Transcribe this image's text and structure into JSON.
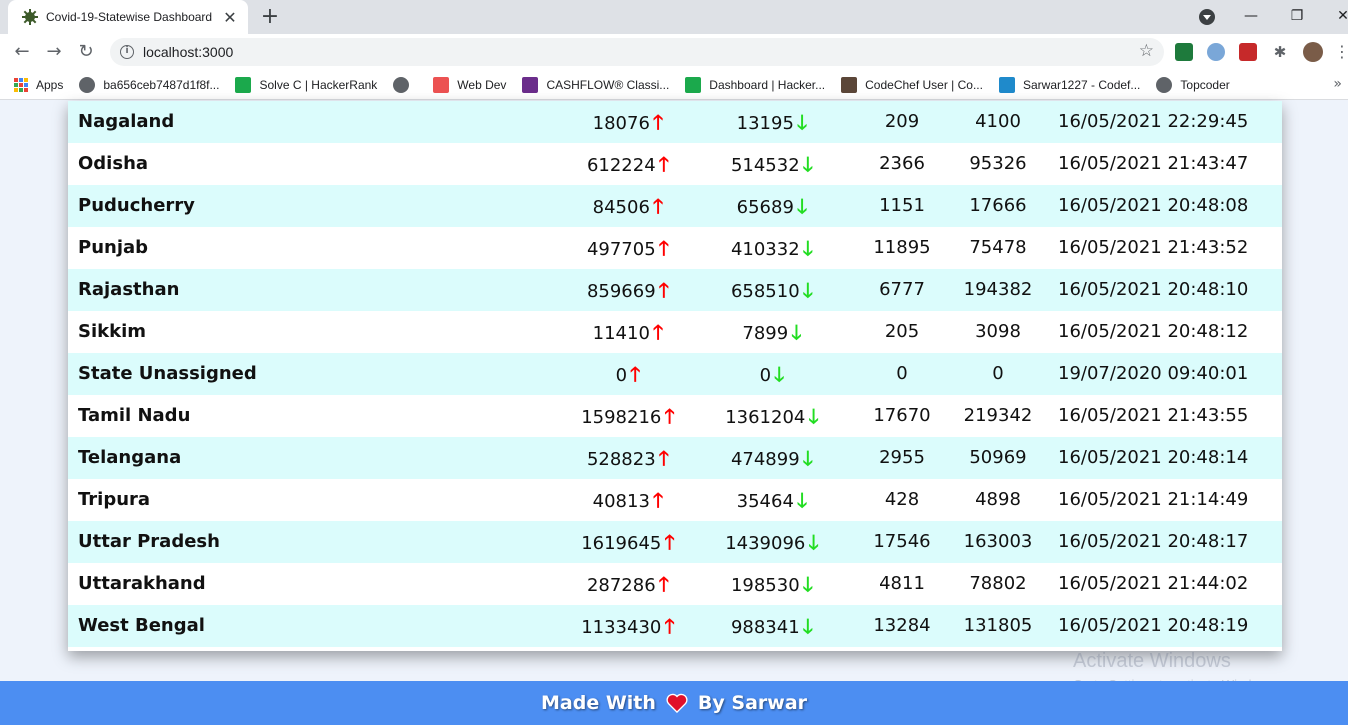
{
  "browser": {
    "tab_title": "Covid-19-Statewise Dashboard",
    "tab_close": "✕",
    "new_tab": "+",
    "url": "localhost:3000",
    "bookmarks": [
      {
        "label": "Apps",
        "icon": "apps-grid-icon",
        "color": "#4285f4"
      },
      {
        "label": "ba656ceb7487d1f8f...",
        "icon": "globe-icon",
        "color": "#5f6368"
      },
      {
        "label": "Solve C | HackerRank",
        "icon": "hackerrank-icon",
        "color": "#1ba94c"
      },
      {
        "label": "",
        "icon": "globe-icon",
        "color": "#5f6368"
      },
      {
        "label": "Web Dev",
        "icon": "udemy-icon",
        "color": "#ec5252"
      },
      {
        "label": "CASHFLOW® Classi...",
        "icon": "cashflow-icon",
        "color": "#6b2d8b"
      },
      {
        "label": "Dashboard | Hacker...",
        "icon": "hackerrank-icon",
        "color": "#1ba94c"
      },
      {
        "label": "CodeChef User | Co...",
        "icon": "codechef-icon",
        "color": "#5b4638"
      },
      {
        "label": "Sarwar1227 - Codef...",
        "icon": "codeforces-icon",
        "color": "#1f8acb"
      },
      {
        "label": "Topcoder",
        "icon": "globe-icon",
        "color": "#5f6368"
      }
    ],
    "bookmarks_more": "»"
  },
  "table": {
    "rows": [
      {
        "state": "Nagaland",
        "confirmed": "18076",
        "recovered": "13195",
        "deaths": "209",
        "active": "4100",
        "updated": "16/05/2021 22:29:45"
      },
      {
        "state": "Odisha",
        "confirmed": "612224",
        "recovered": "514532",
        "deaths": "2366",
        "active": "95326",
        "updated": "16/05/2021 21:43:47"
      },
      {
        "state": "Puducherry",
        "confirmed": "84506",
        "recovered": "65689",
        "deaths": "1151",
        "active": "17666",
        "updated": "16/05/2021 20:48:08"
      },
      {
        "state": "Punjab",
        "confirmed": "497705",
        "recovered": "410332",
        "deaths": "11895",
        "active": "75478",
        "updated": "16/05/2021 21:43:52"
      },
      {
        "state": "Rajasthan",
        "confirmed": "859669",
        "recovered": "658510",
        "deaths": "6777",
        "active": "194382",
        "updated": "16/05/2021 20:48:10"
      },
      {
        "state": "Sikkim",
        "confirmed": "11410",
        "recovered": "7899",
        "deaths": "205",
        "active": "3098",
        "updated": "16/05/2021 20:48:12"
      },
      {
        "state": "State Unassigned",
        "confirmed": "0",
        "recovered": "0",
        "deaths": "0",
        "active": "0",
        "updated": "19/07/2020 09:40:01"
      },
      {
        "state": "Tamil Nadu",
        "confirmed": "1598216",
        "recovered": "1361204",
        "deaths": "17670",
        "active": "219342",
        "updated": "16/05/2021 21:43:55"
      },
      {
        "state": "Telangana",
        "confirmed": "528823",
        "recovered": "474899",
        "deaths": "2955",
        "active": "50969",
        "updated": "16/05/2021 20:48:14"
      },
      {
        "state": "Tripura",
        "confirmed": "40813",
        "recovered": "35464",
        "deaths": "428",
        "active": "4898",
        "updated": "16/05/2021 21:14:49"
      },
      {
        "state": "Uttar Pradesh",
        "confirmed": "1619645",
        "recovered": "1439096",
        "deaths": "17546",
        "active": "163003",
        "updated": "16/05/2021 20:48:17"
      },
      {
        "state": "Uttarakhand",
        "confirmed": "287286",
        "recovered": "198530",
        "deaths": "4811",
        "active": "78802",
        "updated": "16/05/2021 21:44:02"
      },
      {
        "state": "West Bengal",
        "confirmed": "1133430",
        "recovered": "988341",
        "deaths": "13284",
        "active": "131805",
        "updated": "16/05/2021 20:48:19"
      }
    ],
    "up_arrow": "🡑",
    "down_arrow": "🡓"
  },
  "watermark": {
    "line1": "Activate Windows",
    "line2": "Go to Settings to activate Windows."
  },
  "footer": {
    "before": "Made With",
    "after": "By Sarwar",
    "heart_color": "#e0102a"
  }
}
